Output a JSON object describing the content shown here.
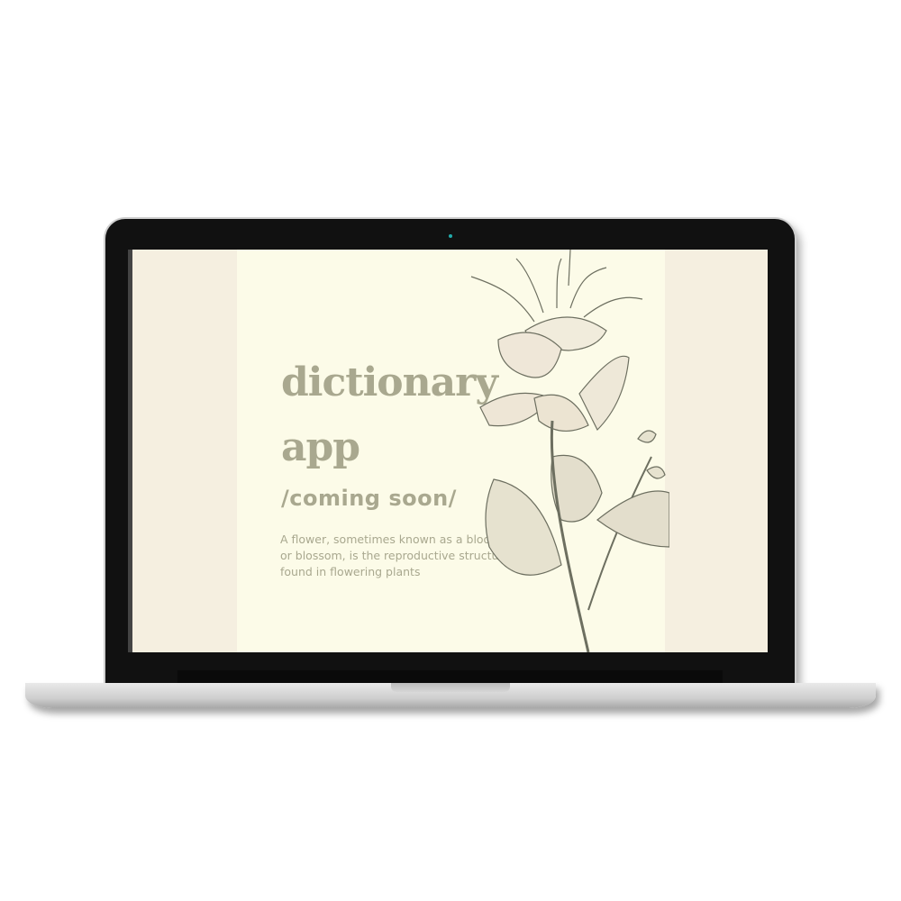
{
  "device": {
    "type": "laptop-mockup"
  },
  "page": {
    "title_line1": "dictionary",
    "title_line2": "app",
    "subtitle": "/coming soon/",
    "description": "A flower, sometimes known as a bloom or blossom, is the reproductive structure found in flowering plants"
  },
  "colors": {
    "side_band": "#f5efe0",
    "center": "#fcfbe8",
    "text": "#a9a88f"
  },
  "illustration": "botanical-flower-engraving"
}
